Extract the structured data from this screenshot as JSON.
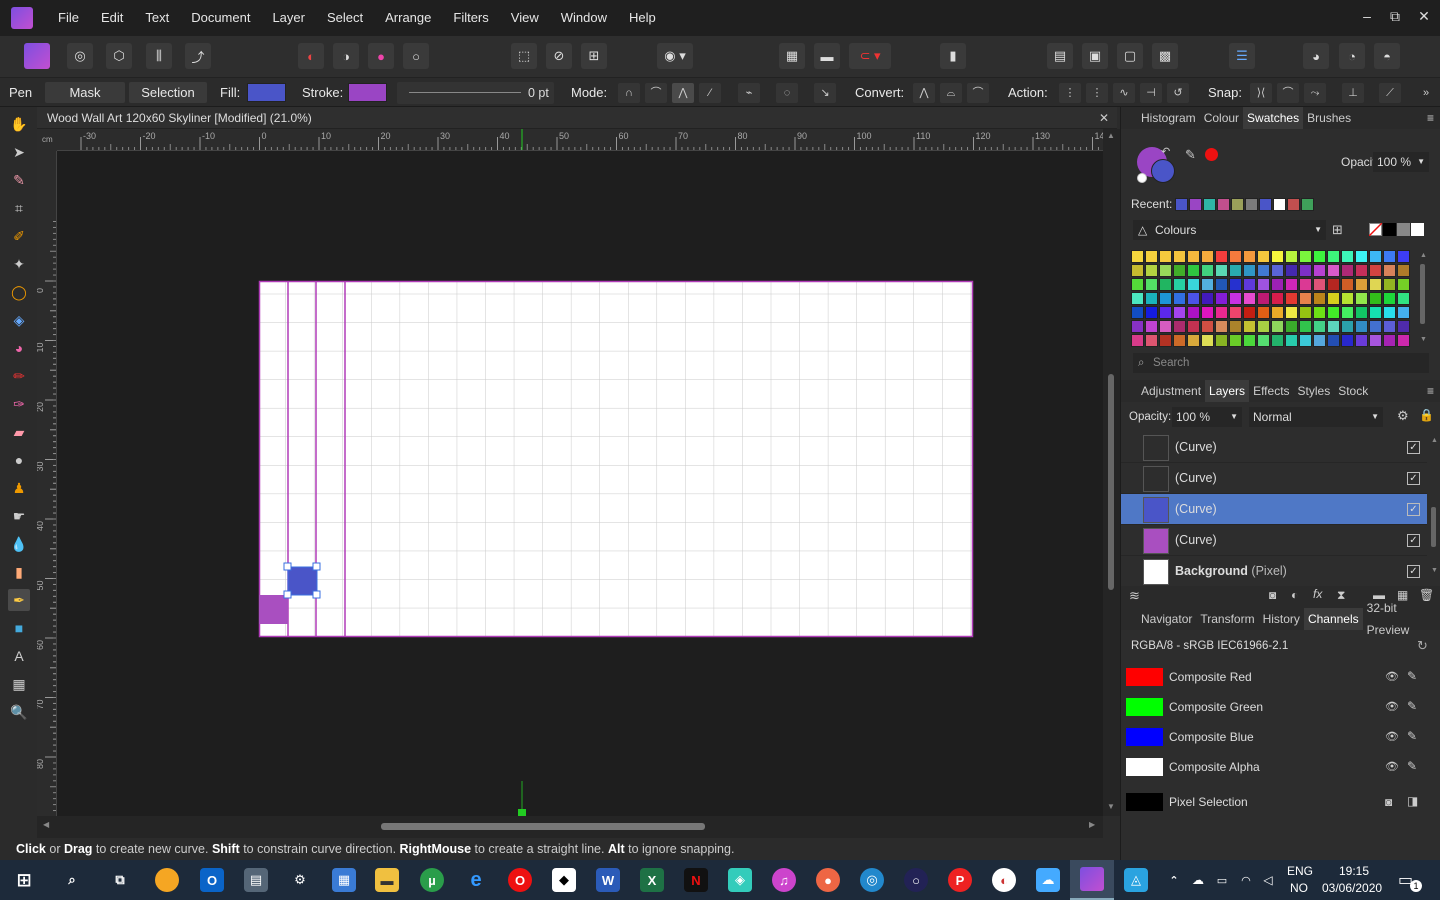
{
  "app": {
    "logo_icon": "affinity-photo-icon",
    "menu": [
      "File",
      "Edit",
      "Text",
      "Document",
      "Layer",
      "Select",
      "Arrange",
      "Filters",
      "View",
      "Window",
      "Help"
    ],
    "window_controls": [
      "–",
      "⧉",
      "✕"
    ]
  },
  "context": {
    "tool_name": "Pen",
    "mask_label": "Mask",
    "selection_label": "Selection",
    "fill_label": "Fill:",
    "fill_color": "#4a55c8",
    "stroke_label": "Stroke:",
    "stroke_color": "#9a45c4",
    "stroke_width": "0 pt",
    "mode_label": "Mode:",
    "convert_label": "Convert:",
    "action_label": "Action:",
    "snap_label": "Snap:"
  },
  "document": {
    "title": "Wood Wall Art 120x60 Skyliner [Modified] (21.0%)",
    "close": "✕",
    "ruler_unit": "cm",
    "ruler_top_ticks": [
      "-30",
      "-20",
      "-10",
      "0",
      "10",
      "20",
      "30",
      "40",
      "50",
      "60",
      "70",
      "80",
      "90",
      "100",
      "110",
      "120",
      "130",
      "140"
    ],
    "ruler_left_ticks": [
      "0",
      "10",
      "20",
      "30",
      "40",
      "50",
      "60",
      "70",
      "80"
    ]
  },
  "status": {
    "click": "Click",
    "t1": " or ",
    "drag": "Drag",
    "t2": " to create new curve. ",
    "shift": "Shift",
    "t3": " to constrain curve direction. ",
    "right": "RightMouse",
    "t4": " to create a straight line. ",
    "alt": "Alt",
    "t5": " to ignore snapping."
  },
  "swatches_panel": {
    "tabs": [
      "Histogram",
      "Colour",
      "Swatches",
      "Brushes"
    ],
    "active": "Swatches",
    "opacity_label": "Opacity:",
    "opacity_value": "100 %",
    "recent_label": "Recent:",
    "palette_name": "Colours",
    "search_placeholder": "Search",
    "primary_color": "#9a45c4",
    "secondary_color": "#4a55c8",
    "recent": [
      "#4a55c8",
      "#9a45c4",
      "#2fb5a6",
      "#c24f8d",
      "#9aa05a",
      "#7a7a7a",
      "#4a55c8",
      "#ffffff",
      "#c24f4f",
      "#3fa05a"
    ]
  },
  "layers_panel": {
    "tabs": [
      "Adjustment",
      "Layers",
      "Effects",
      "Styles",
      "Stock"
    ],
    "active": "Layers",
    "opacity_label": "Opacity:",
    "opacity_value": "100 %",
    "blend_mode": "Normal",
    "layers": [
      {
        "name": "(Curve)",
        "color": "#2d2d2d",
        "checked": "✓"
      },
      {
        "name": "(Curve)",
        "color": "#2d2d2d",
        "checked": "✓"
      },
      {
        "name": "(Curve)",
        "color": "#4a55c8",
        "checked": "✓",
        "selected": true
      },
      {
        "name": "(Curve)",
        "color": "#a94fc0",
        "checked": "✓"
      },
      {
        "name": "Background",
        "suffix": " (Pixel)",
        "color": "#ffffff",
        "checked": "✓"
      }
    ]
  },
  "channels_panel": {
    "tabs": [
      "Navigator",
      "Transform",
      "History",
      "Channels",
      "32-bit Preview"
    ],
    "active": "Channels",
    "color_profile": "RGBA/8 - sRGB IEC61966-2.1",
    "channels": [
      {
        "name": "Composite Red",
        "color": "#ff0000"
      },
      {
        "name": "Composite Green",
        "color": "#00ff00"
      },
      {
        "name": "Composite Blue",
        "color": "#0000ff"
      },
      {
        "name": "Composite Alpha",
        "color": "#ffffff"
      }
    ],
    "pixel_selection": {
      "name": "Pixel Selection",
      "color": "#000000"
    }
  },
  "taskbar": {
    "lang1": "ENG",
    "lang2": "NO",
    "time": "19:15",
    "date": "03/06/2020",
    "notification_count": "1"
  }
}
